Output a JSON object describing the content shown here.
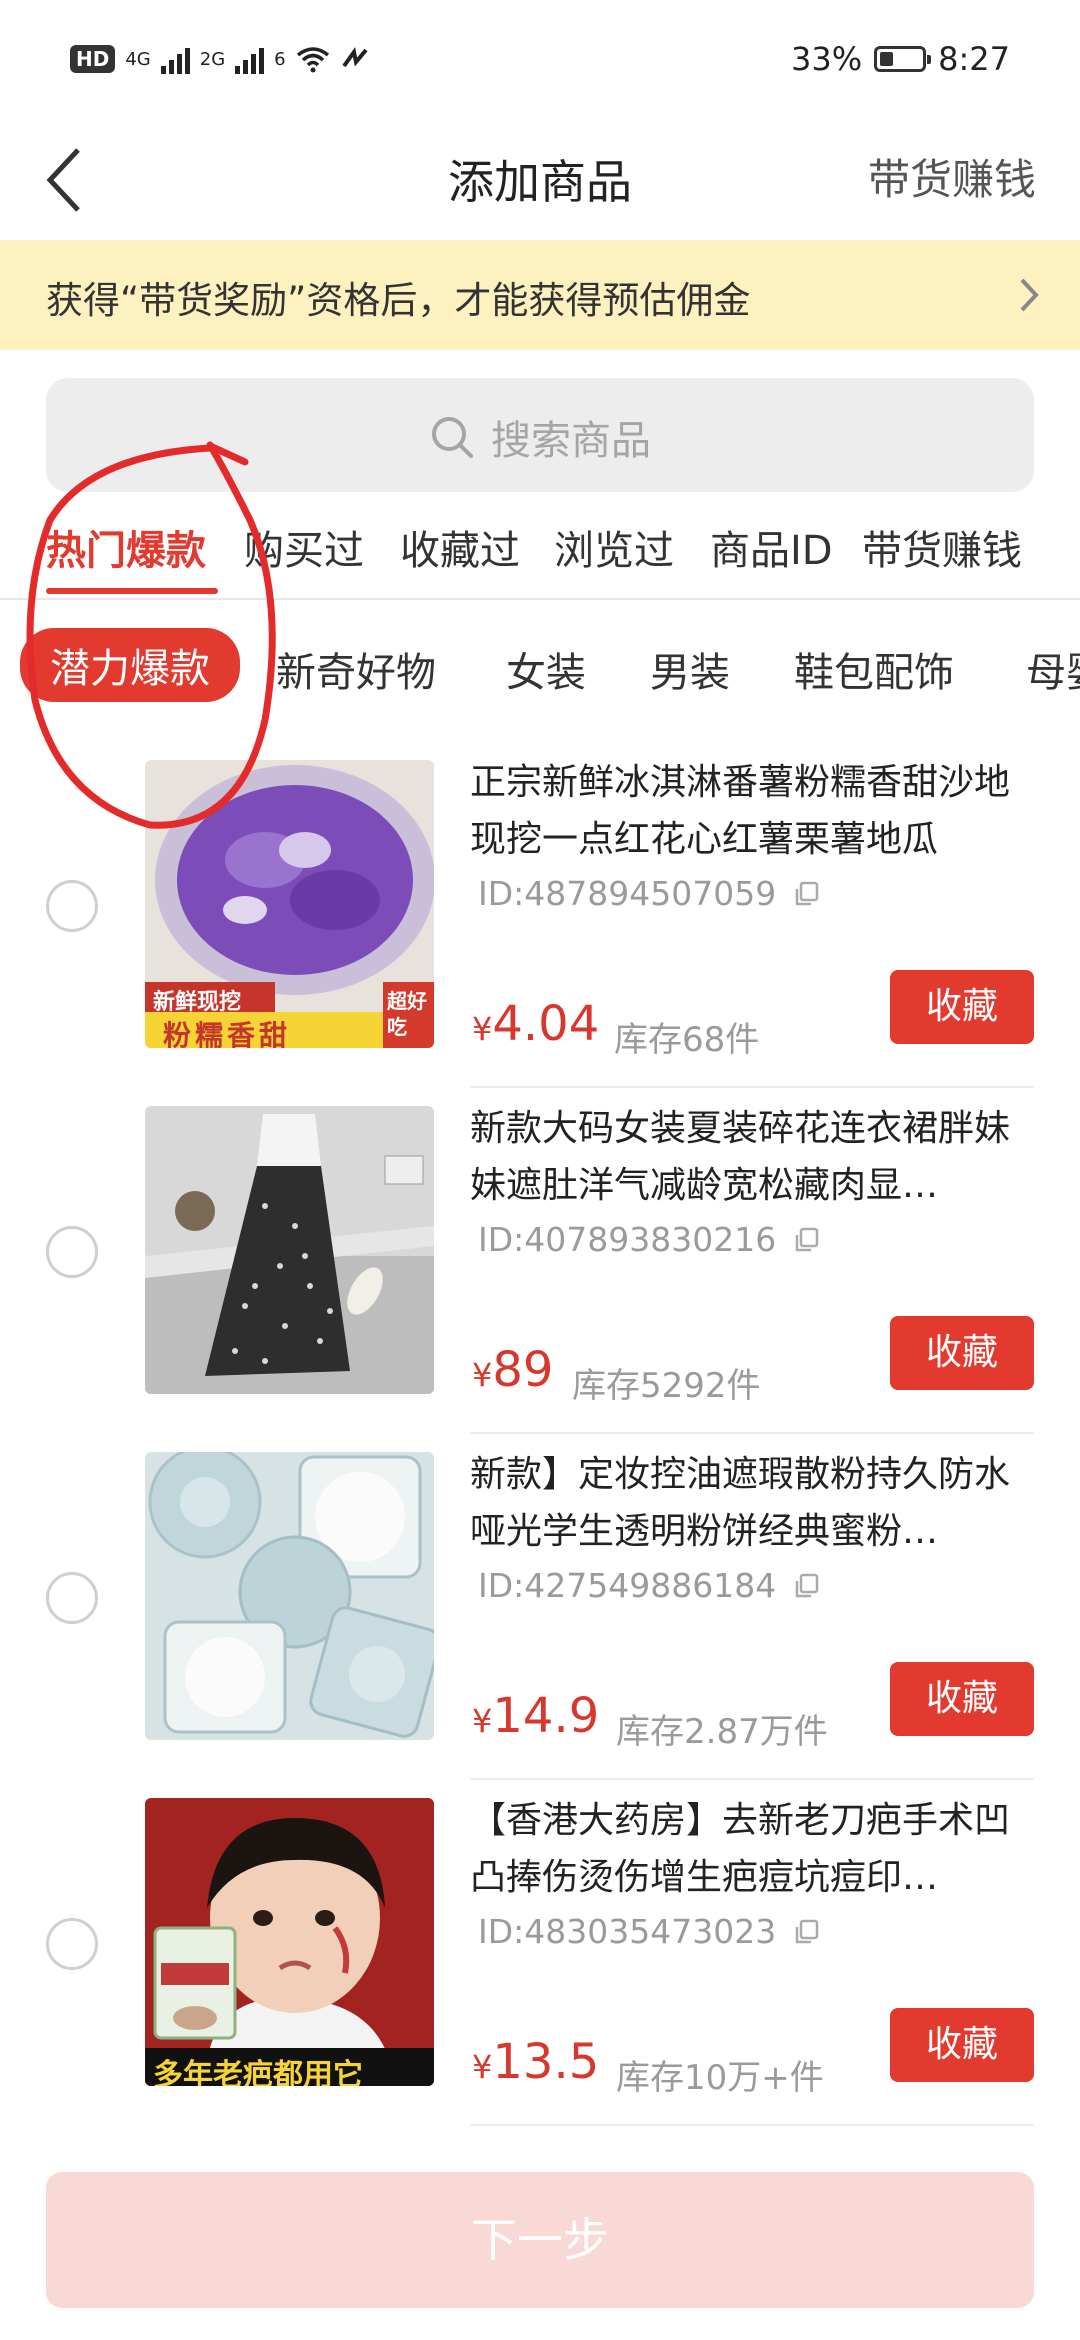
{
  "status_bar": {
    "hd": "HD",
    "net1": "4G",
    "net2": "2G",
    "net3": "6",
    "battery_pct": "33%",
    "battery_level": 0.33,
    "time": "8:27"
  },
  "nav": {
    "back_icon": "chevron-left-icon",
    "title": "添加商品",
    "right_link": "带货赚钱"
  },
  "notice": {
    "text": "获得“带货奖励”资格后，才能获得预估佣金",
    "arrow_icon": "chevron-right-icon",
    "background": "#fdf1bf"
  },
  "search": {
    "placeholder": "搜索商品",
    "icon": "search-icon"
  },
  "tabs": [
    {
      "label": "热门爆款",
      "active": true
    },
    {
      "label": "购买过"
    },
    {
      "label": "收藏过"
    },
    {
      "label": "浏览过"
    },
    {
      "label": "商品ID"
    },
    {
      "label": "带货赚钱"
    }
  ],
  "categories": [
    {
      "label": "潜力爆款",
      "active": true
    },
    {
      "label": "新奇好物"
    },
    {
      "label": "女装"
    },
    {
      "label": "男装"
    },
    {
      "label": "鞋包配饰"
    },
    {
      "label": "母婴"
    }
  ],
  "products": [
    {
      "title": "正宗新鲜冰淇淋番薯粉糯香甜沙地现挖一点红花心红薯栗薯地瓜",
      "id": "ID:487894507059",
      "currency": "¥",
      "price": "4.04",
      "stock": "库存68件",
      "button": "收藏",
      "badge_top": "新鲜现挖",
      "badge_bottom": "粉糯香甜",
      "badge_corner": "超好吃"
    },
    {
      "title": "新款大码女装夏装碎花连衣裙胖妹妹遮肚洋气减龄宽松藏肉显…",
      "id": "ID:407893830216",
      "currency": "¥",
      "price": "89",
      "stock": "库存5292件",
      "button": "收藏"
    },
    {
      "title": "新款】定妆控油遮瑕散粉持久防水哑光学生透明粉饼经典蜜粉…",
      "id": "ID:427549886184",
      "currency": "¥",
      "price": "14.9",
      "stock": "库存2.87万件",
      "button": "收藏"
    },
    {
      "title": "【香港大药房】去新老刀疤手术凹凸捧伤烫伤增生疤痘坑痘印…",
      "id": "ID:483035473023",
      "currency": "¥",
      "price": "13.5",
      "stock": "库存10万+件",
      "button": "收藏",
      "badge_bottom": "多年老疤都用它"
    }
  ],
  "footer": {
    "next_label": "下一步"
  },
  "colors": {
    "accent": "#e23a2f",
    "price": "#d7372d",
    "next_disabled": "#f9d9d5"
  }
}
